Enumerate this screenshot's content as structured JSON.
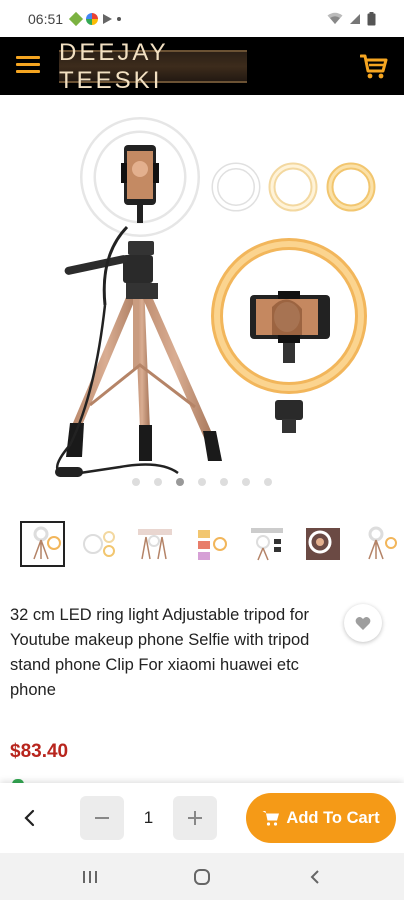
{
  "status_bar": {
    "time": "06:51"
  },
  "header": {
    "logo_text": "DEEJAY TEESKI"
  },
  "colors": {
    "accent": "#f59a17",
    "price": "#b8251d",
    "header_bg": "#000000"
  },
  "product": {
    "title": "32 cm LED ring light Adjustable tripod for Youtube makeup phone Selfie with tripod stand phone Clip For xiaomi huawei etc phone",
    "price": "$83.40",
    "image_count": 7,
    "active_image": 3
  },
  "actions": {
    "quantity": "1",
    "add_to_cart": "Add To Cart"
  },
  "icons": {
    "menu": "menu-icon",
    "cart": "cart-icon",
    "wishlist": "heart-icon",
    "back": "chevron-left-icon",
    "minus": "minus-icon",
    "plus": "plus-icon"
  }
}
